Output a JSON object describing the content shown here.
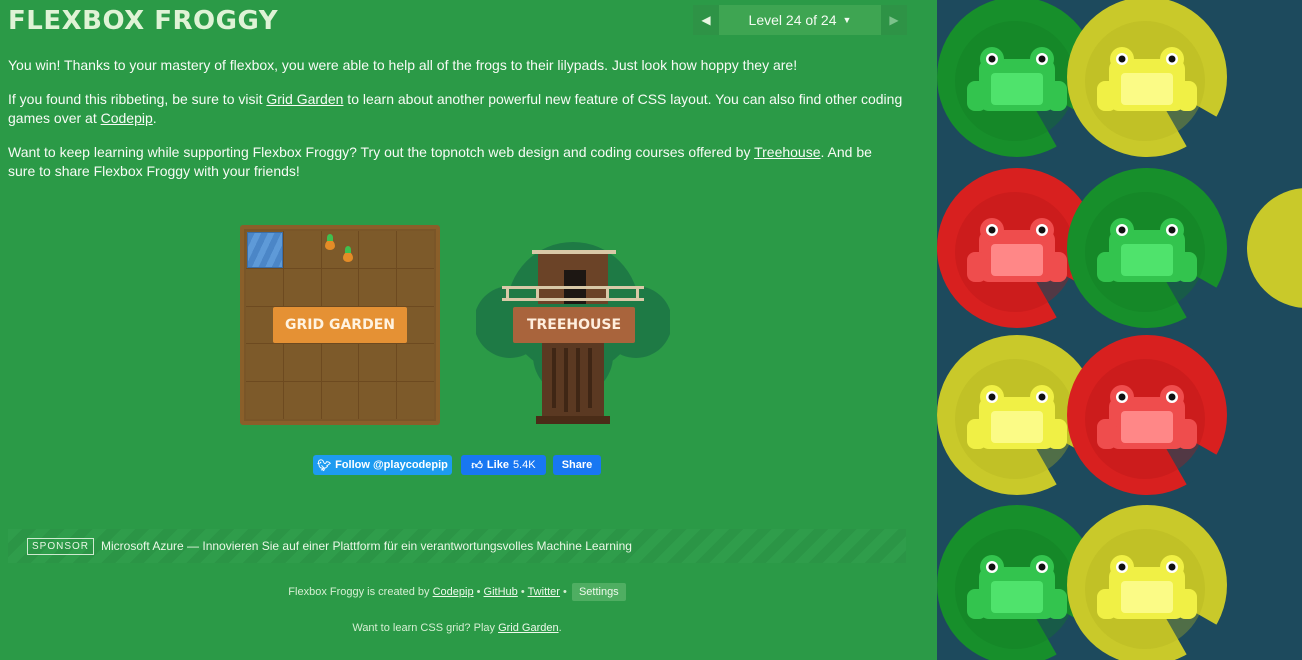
{
  "header": {
    "title": "FLEXBOX FROGGY",
    "level_label": "Level 24 of 24",
    "prev_icon": "triangle-left-icon",
    "next_icon": "triangle-right-icon"
  },
  "content": {
    "p1": "You win! Thanks to your mastery of flexbox, you were able to help all of the frogs to their lilypads. Just look how hoppy they are!",
    "p2_a": "If you found this ribbeting, be sure to visit ",
    "p2_link1": "Grid Garden",
    "p2_b": " to learn about another powerful new feature of CSS layout. You can also find other coding games over at ",
    "p2_link2": "Codepip",
    "p2_c": ".",
    "p3_a": "Want to keep learning while supporting Flexbox Froggy? Try out the topnotch web design and coding courses offered by ",
    "p3_link": "Treehouse",
    "p3_b": ". And be sure to share Flexbox Froggy with your friends!"
  },
  "promos": {
    "grid_garden_label": "GRID GARDEN",
    "treehouse_label": "TREEHOUSE"
  },
  "social": {
    "twitter_label": "Follow @playcodepip",
    "fb_like_label": "Like",
    "fb_like_count": "5.4K",
    "fb_share_label": "Share"
  },
  "sponsor": {
    "badge": "SPONSOR",
    "text": "Microsoft Azure — Innovieren Sie auf einer Plattform für ein verantwortungsvolles Machine Learning"
  },
  "footer": {
    "created_by": "Flexbox Froggy is created by ",
    "codepip": "Codepip",
    "sep1": " • ",
    "github": "GitHub",
    "sep2": " • ",
    "twitter": "Twitter",
    "sep3": " • ",
    "settings": "Settings",
    "learn_a": "Want to learn CSS grid? Play ",
    "learn_link": "Grid Garden",
    "learn_b": "."
  },
  "colors": {
    "left_bg": "#2b9a47",
    "board_bg": "#1d4a5d",
    "frog_green": "#2fbf4b",
    "frog_yellow": "#e8e83a",
    "frog_red": "#e83a3a"
  },
  "board": {
    "frogs": [
      {
        "color": "green"
      },
      {
        "color": "yellow"
      },
      {
        "color": "red"
      },
      {
        "color": "green"
      },
      {
        "color": "yellow"
      },
      {
        "color": "red"
      },
      {
        "color": "green"
      },
      {
        "color": "yellow"
      }
    ]
  }
}
